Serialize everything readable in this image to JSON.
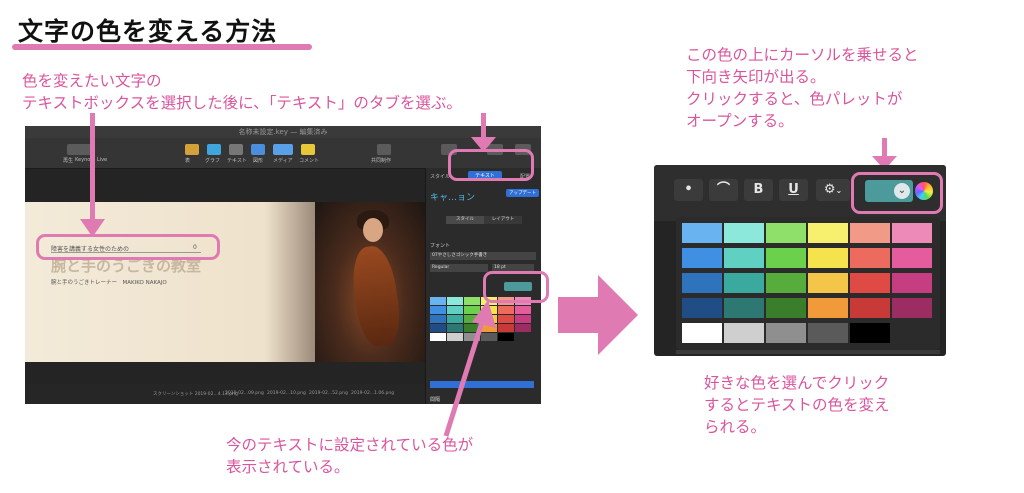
{
  "title": "文字の色を変える方法",
  "note_top_left": [
    "色を変えたい文字の",
    "テキストボックスを選択した後に、「テキスト」のタブを選ぶ。"
  ],
  "note_bottom_left": [
    "今のテキストに設定されている色が",
    "表示されている。"
  ],
  "note_top_right": [
    "この色の上にカーソルを乗せると",
    "下向き矢印が出る。",
    "クリックすると、色パレットが",
    "オープンする。"
  ],
  "note_bottom_right": [
    "好きな色を選んでクリック",
    "するとテキストの色を変え",
    "られる。"
  ],
  "keynote": {
    "window_title": "名称未設定.key — 編集済み",
    "toolbar_left": [
      "再生",
      "Keynote Live"
    ],
    "toolbar_mid": [
      "表",
      "グラフ",
      "テキスト",
      "図形",
      "メディア",
      "コメント"
    ],
    "toolbar_right": [
      "共同制作",
      "フォーマット",
      "アニメーション",
      "書類"
    ],
    "inspector_tabs": [
      "スタイル",
      "テキスト",
      "配置"
    ],
    "style_preview": "キャ…ョン",
    "update_button": "アップデート",
    "segment": [
      "スタイル",
      "レイアウト"
    ],
    "font_label": "フォント",
    "font_name": "07やさしさゴシック手書き",
    "font_style": "Regular",
    "font_size": "18 pt",
    "spacing_label": "間隔",
    "slide_line1": "障害を講義する女性のための",
    "slide_line1_count": "0",
    "slide_title": "腕と手のうごきの教室",
    "slide_line3": "腕と手のうごきトレーナー　MAKIKO NAKAJO",
    "filmstrip": [
      "スクリーンショット 2019-02...4.13.png",
      "2019-02...09.png",
      "2019-02...10.png",
      "2019-02...52.png",
      "2019-02...1.06.png",
      "2019-02...09.png",
      "2019-02....11.png"
    ]
  },
  "palette": {
    "buttons": [
      "•",
      "⌒",
      "B",
      "U",
      "⚙"
    ],
    "current_color": "#4d9a9d",
    "rows": [
      [
        "#69b4f0",
        "#8de8dc",
        "#8ee06a",
        "#f7ef6e",
        "#f29a88",
        "#ee8ab8"
      ],
      [
        "#3f90e2",
        "#5fd0c2",
        "#6bd14c",
        "#f5e24c",
        "#ec6b5e",
        "#e45c9e"
      ],
      [
        "#2f73bd",
        "#3aa99e",
        "#56ad3c",
        "#f3c649",
        "#e04a44",
        "#c63d82"
      ],
      [
        "#204d86",
        "#2e7873",
        "#3a7d2a",
        "#f09a3a",
        "#c73a38",
        "#9c2d62"
      ],
      [
        "#ffffff",
        "#cfcfcf",
        "#8f8f8f",
        "#5a5a5a",
        "#000000",
        ""
      ]
    ]
  },
  "colors": {
    "accent": "#e07ab2",
    "note_text": "#d9559e"
  }
}
